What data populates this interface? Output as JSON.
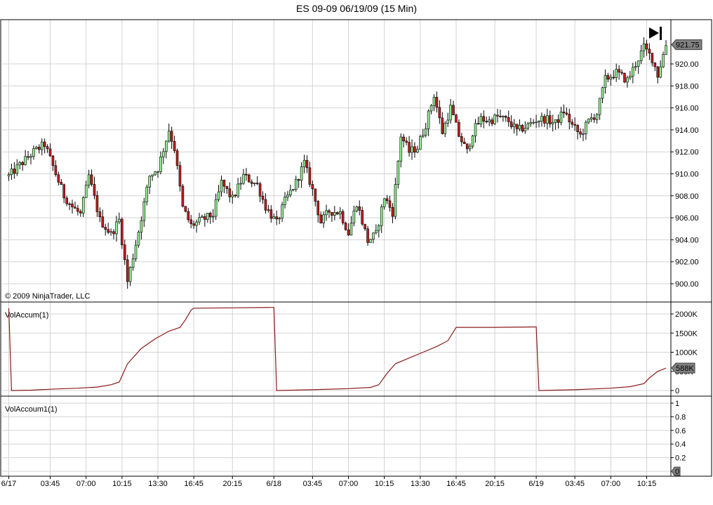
{
  "title": "ES 09-09  06/19/09 (15 Min)",
  "copyright": "© 2009 NinjaTrader, LLC",
  "colors": {
    "up": "#90ee90",
    "down": "#c41e1e",
    "wick": "#000000",
    "line": "#8b1a1a",
    "grid": "#d3d3d3",
    "price_tag": "#808080"
  },
  "chart_data": [
    {
      "type": "candlestick",
      "title": "ES 09-09  06/19/09 (15 Min)",
      "ylim": [
        899.0,
        925.0
      ],
      "y_ticks": [
        "900.00",
        "902.00",
        "904.00",
        "906.00",
        "908.00",
        "910.00",
        "912.00",
        "914.00",
        "916.00",
        "918.00",
        "920.00"
      ],
      "last_price": "921.75",
      "grid": true,
      "anchors": [
        [
          0,
          909.8
        ],
        [
          4,
          910.8
        ],
        [
          9,
          912.0
        ],
        [
          13,
          912.7
        ],
        [
          17,
          910.0
        ],
        [
          20,
          908.0
        ],
        [
          23,
          907.0
        ],
        [
          26,
          906.3
        ],
        [
          29,
          909.8
        ],
        [
          33,
          905.8
        ],
        [
          37,
          904.5
        ],
        [
          40,
          905.8
        ],
        [
          43,
          900.2
        ],
        [
          47,
          904.8
        ],
        [
          51,
          909.8
        ],
        [
          54,
          910.5
        ],
        [
          58,
          914.0
        ],
        [
          60,
          912.3
        ],
        [
          63,
          906.9
        ],
        [
          66,
          905.3
        ],
        [
          70,
          905.8
        ],
        [
          74,
          906.3
        ],
        [
          77,
          909.2
        ],
        [
          81,
          907.7
        ],
        [
          85,
          909.8
        ],
        [
          90,
          909.0
        ],
        [
          93,
          907.0
        ],
        [
          97,
          905.5
        ],
        [
          100,
          907.5
        ],
        [
          104,
          909.2
        ],
        [
          107,
          911.0
        ],
        [
          110,
          908.5
        ],
        [
          113,
          905.6
        ],
        [
          116,
          906.6
        ],
        [
          120,
          906.5
        ],
        [
          123,
          904.6
        ],
        [
          126,
          907.4
        ],
        [
          130,
          903.9
        ],
        [
          133,
          904.5
        ],
        [
          136,
          907.9
        ],
        [
          139,
          906.5
        ],
        [
          142,
          913.5
        ],
        [
          145,
          912.0
        ],
        [
          148,
          912.4
        ],
        [
          151,
          914.5
        ],
        [
          154,
          917.2
        ],
        [
          157,
          913.8
        ],
        [
          160,
          916.0
        ],
        [
          163,
          913.5
        ],
        [
          166,
          912.0
        ],
        [
          168,
          913.8
        ],
        [
          171,
          915.0
        ],
        [
          174,
          914.8
        ],
        [
          177,
          915.2
        ],
        [
          181,
          914.8
        ],
        [
          184,
          913.9
        ],
        [
          188,
          914.4
        ],
        [
          191,
          914.9
        ],
        [
          194,
          915.0
        ],
        [
          198,
          914.6
        ],
        [
          201,
          915.7
        ],
        [
          204,
          914.4
        ],
        [
          207,
          913.5
        ],
        [
          210,
          914.8
        ],
        [
          213,
          915.5
        ],
        [
          216,
          918.6
        ],
        [
          220,
          919.2
        ],
        [
          224,
          918.5
        ],
        [
          227,
          920.0
        ],
        [
          230,
          921.5
        ],
        [
          233,
          920.5
        ],
        [
          235,
          919.0
        ],
        [
          238,
          921.75
        ]
      ],
      "time_ticks": [
        {
          "label": "6/17",
          "bar": 0
        },
        {
          "label": "03:45",
          "bar": 15
        },
        {
          "label": "07:00",
          "bar": 28
        },
        {
          "label": "10:15",
          "bar": 41
        },
        {
          "label": "13:30",
          "bar": 54
        },
        {
          "label": "16:45",
          "bar": 67
        },
        {
          "label": "20:15",
          "bar": 81
        },
        {
          "label": "6/18",
          "bar": 96
        },
        {
          "label": "03:45",
          "bar": 110
        },
        {
          "label": "07:00",
          "bar": 123
        },
        {
          "label": "10:15",
          "bar": 136
        },
        {
          "label": "13:30",
          "bar": 149
        },
        {
          "label": "16:45",
          "bar": 162
        },
        {
          "label": "20:15",
          "bar": 176
        },
        {
          "label": "6/19",
          "bar": 191
        },
        {
          "label": "03:45",
          "bar": 205
        },
        {
          "label": "07:00",
          "bar": 218
        },
        {
          "label": "10:15",
          "bar": 231
        }
      ]
    },
    {
      "type": "line",
      "title": "VolAccum(1)",
      "ylim": [
        -100000,
        2250000
      ],
      "y_ticks": [
        "2000K",
        "1500K",
        "1000K",
        "500K",
        "0"
      ],
      "last_value": "588K",
      "points": [
        [
          0,
          2150000
        ],
        [
          1,
          0
        ],
        [
          8,
          10000
        ],
        [
          17,
          40000
        ],
        [
          25,
          60000
        ],
        [
          32,
          90000
        ],
        [
          37,
          150000
        ],
        [
          40,
          220000
        ],
        [
          43,
          700000
        ],
        [
          48,
          1100000
        ],
        [
          53,
          1350000
        ],
        [
          58,
          1550000
        ],
        [
          62,
          1650000
        ],
        [
          64,
          1850000
        ],
        [
          66,
          2100000
        ],
        [
          67,
          2150000
        ],
        [
          80,
          2160000
        ],
        [
          95,
          2170000
        ],
        [
          96,
          2170000
        ],
        [
          97,
          0
        ],
        [
          110,
          20000
        ],
        [
          123,
          50000
        ],
        [
          131,
          80000
        ],
        [
          134,
          150000
        ],
        [
          137,
          450000
        ],
        [
          140,
          700000
        ],
        [
          145,
          850000
        ],
        [
          150,
          1000000
        ],
        [
          155,
          1150000
        ],
        [
          159,
          1300000
        ],
        [
          162,
          1650000
        ],
        [
          175,
          1650000
        ],
        [
          190,
          1660000
        ],
        [
          191,
          1660000
        ],
        [
          192,
          0
        ],
        [
          205,
          20000
        ],
        [
          218,
          60000
        ],
        [
          225,
          100000
        ],
        [
          230,
          180000
        ],
        [
          232,
          330000
        ],
        [
          235,
          500000
        ],
        [
          238,
          588000
        ]
      ]
    },
    {
      "type": "line",
      "title": "VolAccoum1(1)",
      "ylim": [
        -0.02,
        1.05
      ],
      "y_ticks": [
        "1",
        "0.8",
        "0.6",
        "0.4",
        "0.2"
      ],
      "last_value": "0",
      "points": []
    }
  ]
}
